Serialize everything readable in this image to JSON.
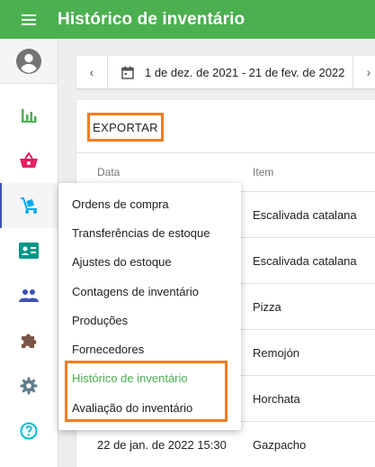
{
  "header": {
    "title": "Histórico de inventário",
    "menu_icon": "hamburger-menu-icon",
    "bg_color": "#4caf50"
  },
  "sidebar": {
    "items": [
      {
        "name": "avatar",
        "icon": "account-circle-icon",
        "color": "#757575"
      },
      {
        "name": "reports",
        "icon": "bar-chart-icon",
        "color": "#4caf50"
      },
      {
        "name": "items",
        "icon": "basket-icon",
        "color": "#e91e63"
      },
      {
        "name": "inventory",
        "icon": "dolly-icon",
        "color": "#03a9f4",
        "active": true
      },
      {
        "name": "customers",
        "icon": "contact-card-icon",
        "color": "#009688"
      },
      {
        "name": "employees",
        "icon": "people-icon",
        "color": "#3f51b5"
      },
      {
        "name": "integrations",
        "icon": "puzzle-piece-icon",
        "color": "#795548"
      },
      {
        "name": "settings",
        "icon": "gear-icon",
        "color": "#607d8b"
      },
      {
        "name": "help",
        "icon": "help-circle-icon",
        "color": "#00bcd4"
      }
    ]
  },
  "datebar": {
    "prev": "‹",
    "next": "›",
    "range": "1 de dez. de 2021 - 21 de fev. de 2022",
    "calendar_icon": "calendar-icon"
  },
  "toolbar": {
    "export_label": "EXPORTAR",
    "highlight_color": "#ef7d22"
  },
  "table": {
    "columns": [
      "Data",
      "Item"
    ],
    "rows": [
      {
        "date": "",
        "item": "Escalivada catalana"
      },
      {
        "date": "",
        "item": "Escalivada catalana"
      },
      {
        "date": "",
        "item": "Pizza"
      },
      {
        "date": "",
        "item": "Remojón"
      },
      {
        "date": "",
        "item": "Horchata"
      },
      {
        "date": "22 de jan. de 2022 15:30",
        "item": "Gazpacho"
      }
    ]
  },
  "menu": {
    "items": [
      "Ordens de compra",
      "Transferências de estoque",
      "Ajustes do estoque",
      "Contagens de inventário",
      "Produções",
      "Fornecedores",
      "Histórico de inventário",
      "Avaliação do inventário"
    ],
    "current_index": 6,
    "current_color": "#4caf50"
  }
}
